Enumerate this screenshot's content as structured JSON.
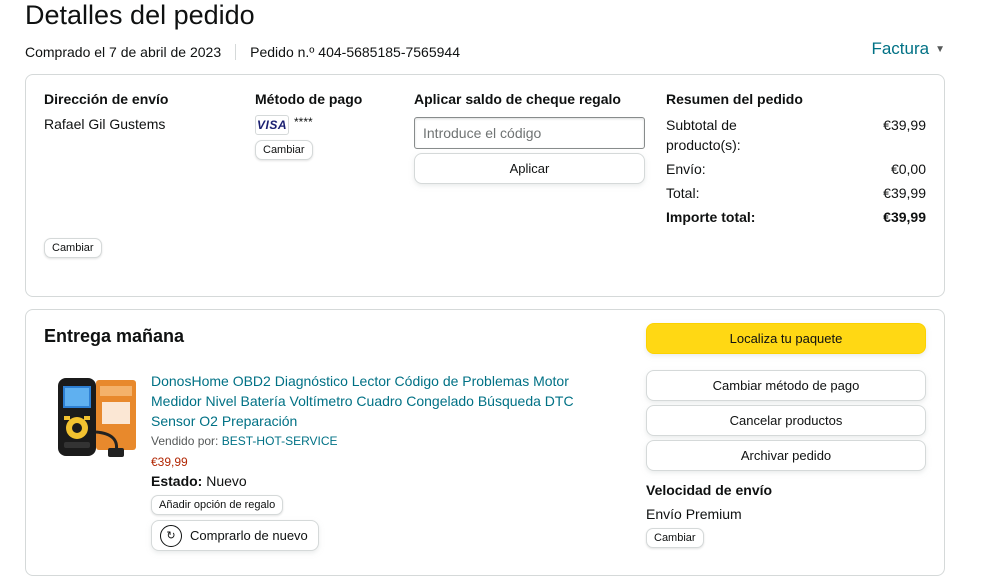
{
  "header": {
    "title": "Detalles del pedido",
    "purchased": "Comprado el 7 de abril de 2023",
    "order_number": "Pedido n.º 404-5685185-7565944",
    "invoice_label": "Factura"
  },
  "shipping": {
    "heading": "Dirección de envío",
    "name": "Rafael Gil Gustems",
    "change_label": "Cambiar"
  },
  "payment": {
    "heading": "Método de pago",
    "card_brand": "VISA",
    "masked": "****",
    "change_label": "Cambiar"
  },
  "gift": {
    "heading": "Aplicar saldo de cheque regalo",
    "placeholder": "Introduce el código",
    "apply_label": "Aplicar"
  },
  "summary": {
    "heading": "Resumen del pedido",
    "subtotal_label": "Subtotal de producto(s):",
    "subtotal_value": "€39,99",
    "shipping_label": "Envío:",
    "shipping_value": "€0,00",
    "total_label": "Total:",
    "total_value": "€39,99",
    "grand_label": "Importe total:",
    "grand_value": "€39,99"
  },
  "delivery": {
    "heading": "Entrega mañana",
    "product_title": "DonosHome OBD2 Diagnóstico Lector Código de Problemas Motor Medidor Nivel Batería Voltímetro Cuadro Congelado Búsqueda DTC Sensor O2 Preparación",
    "sold_by_label": "Vendido por:",
    "seller": "BEST-HOT-SERVICE",
    "price": "€39,99",
    "state_label": "Estado:",
    "state_value": "Nuevo",
    "gift_option_label": "Añadir opción de regalo",
    "buy_again_label": "Comprarlo de nuevo",
    "track_label": "Localiza tu paquete",
    "change_payment_label": "Cambiar método de pago",
    "cancel_label": "Cancelar productos",
    "archive_label": "Archivar pedido",
    "speed_heading": "Velocidad de envío",
    "speed_value": "Envío Premium",
    "speed_change_label": "Cambiar"
  },
  "colors": {
    "link": "#007185",
    "price": "#b12704",
    "primary_button": "#ffd814",
    "border": "#d5d9d9"
  }
}
